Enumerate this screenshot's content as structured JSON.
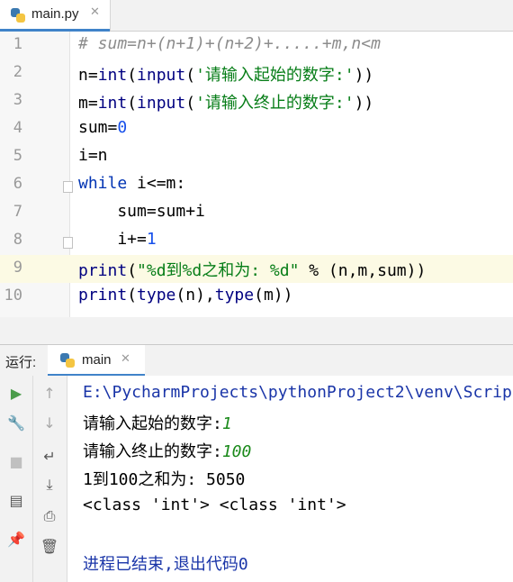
{
  "editor_tab": {
    "filename": "main.py",
    "close_glyph": "✕"
  },
  "lines": [
    {
      "num": "1",
      "tokens": [
        {
          "t": "# sum=n+(n+1)+(n+2)+.....+m,n<m",
          "c": "cmt"
        }
      ]
    },
    {
      "num": "2",
      "tokens": [
        {
          "t": "n=",
          "c": ""
        },
        {
          "t": "int",
          "c": "fn"
        },
        {
          "t": "(",
          "c": ""
        },
        {
          "t": "input",
          "c": "fn"
        },
        {
          "t": "(",
          "c": ""
        },
        {
          "t": "'请输入起始的数字:'",
          "c": "str"
        },
        {
          "t": "))",
          "c": ""
        }
      ]
    },
    {
      "num": "3",
      "tokens": [
        {
          "t": "m=",
          "c": ""
        },
        {
          "t": "int",
          "c": "fn"
        },
        {
          "t": "(",
          "c": ""
        },
        {
          "t": "input",
          "c": "fn"
        },
        {
          "t": "(",
          "c": ""
        },
        {
          "t": "'请输入终止的数字:'",
          "c": "str"
        },
        {
          "t": "))",
          "c": ""
        }
      ]
    },
    {
      "num": "4",
      "tokens": [
        {
          "t": "sum=",
          "c": ""
        },
        {
          "t": "0",
          "c": "num-lit"
        }
      ]
    },
    {
      "num": "5",
      "tokens": [
        {
          "t": "i=n",
          "c": ""
        }
      ]
    },
    {
      "num": "6",
      "tokens": [
        {
          "t": "while",
          "c": "kw"
        },
        {
          "t": " i<=m:",
          "c": ""
        }
      ]
    },
    {
      "num": "7",
      "tokens": [
        {
          "t": "    sum=sum+i",
          "c": ""
        }
      ]
    },
    {
      "num": "8",
      "tokens": [
        {
          "t": "    i+=",
          "c": ""
        },
        {
          "t": "1",
          "c": "num-lit"
        }
      ]
    },
    {
      "num": "9",
      "tokens": [
        {
          "t": "print",
          "c": "fn"
        },
        {
          "t": "(",
          "c": ""
        },
        {
          "t": "\"%d到%d之和为: %d\"",
          "c": "str"
        },
        {
          "t": " % (n,m,sum))",
          "c": ""
        }
      ]
    },
    {
      "num": "10",
      "tokens": [
        {
          "t": "print",
          "c": "fn"
        },
        {
          "t": "(",
          "c": ""
        },
        {
          "t": "type",
          "c": "fn"
        },
        {
          "t": "(n),",
          "c": ""
        },
        {
          "t": "type",
          "c": "fn"
        },
        {
          "t": "(m))",
          "c": ""
        }
      ]
    }
  ],
  "run_panel": {
    "label": "运行:",
    "tab_name": "main",
    "close_glyph": "✕",
    "toolbar_left": [
      {
        "icon": "run-icon",
        "glyph": "▶",
        "color": "#4b9c4b"
      },
      {
        "icon": "wrench-icon",
        "glyph": "🔧",
        "color": "#6e6e6e"
      },
      {
        "icon": "stop-icon",
        "glyph": "■",
        "color": "#c0c0c0"
      },
      {
        "icon": "layout-icon",
        "glyph": "▤",
        "color": "#555555"
      },
      {
        "icon": "pin-icon",
        "glyph": "📌",
        "color": "#555555"
      }
    ],
    "toolbar_right": [
      {
        "icon": "arrow-up-icon",
        "glyph": "↑",
        "color": "#a8a8a8"
      },
      {
        "icon": "arrow-down-icon",
        "glyph": "↓",
        "color": "#a8a8a8"
      },
      {
        "icon": "soft-wrap-icon",
        "glyph": "↵",
        "color": "#555555"
      },
      {
        "icon": "scroll-to-end-icon",
        "glyph": "⤓",
        "color": "#555555"
      },
      {
        "icon": "print-icon",
        "glyph": "⎙",
        "color": "#555555"
      },
      {
        "icon": "trash-icon",
        "glyph": "🗑",
        "color": "#555555"
      }
    ]
  },
  "console": {
    "path": "E:\\PycharmProjects\\pythonProject2\\venv\\Scrip",
    "prompt1": "请输入起始的数字:",
    "input1": "1",
    "prompt2": "请输入终止的数字:",
    "input2": "100",
    "result": "1到100之和为: 5050",
    "types": "<class 'int'> <class 'int'>",
    "exit": "进程已结束,退出代码0"
  }
}
